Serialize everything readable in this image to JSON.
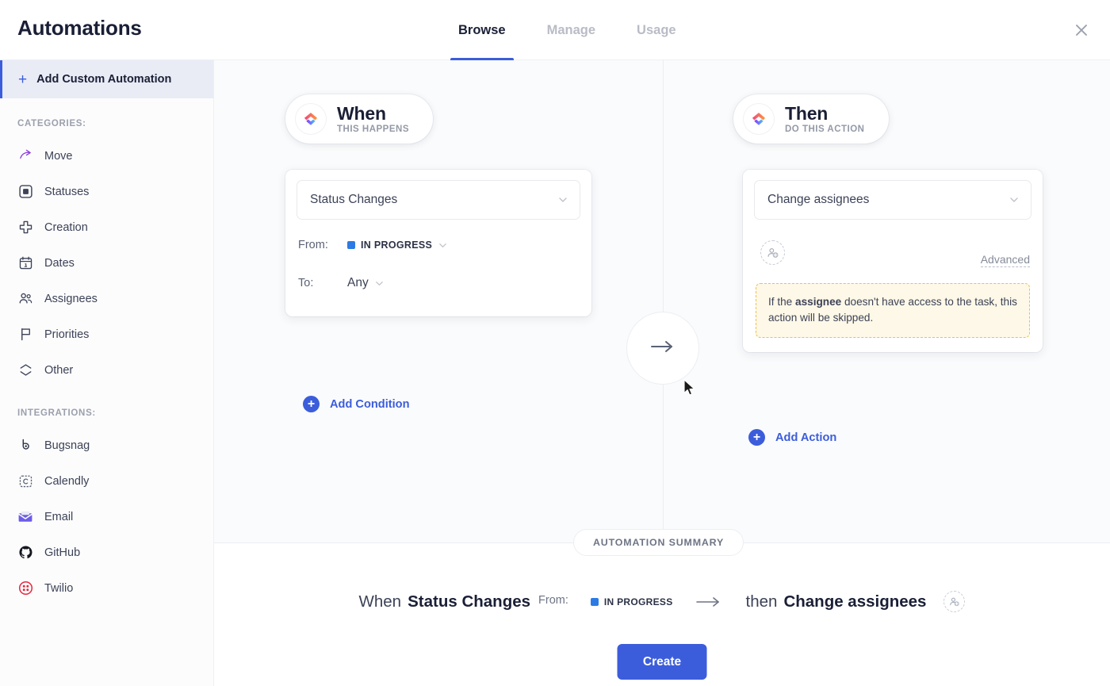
{
  "header": {
    "title": "Automations",
    "tabs": [
      {
        "label": "Browse",
        "active": true
      },
      {
        "label": "Manage",
        "active": false
      },
      {
        "label": "Usage",
        "active": false
      }
    ],
    "close_icon": "close-icon"
  },
  "sidebar": {
    "add_custom": {
      "label": "Add Custom Automation",
      "plus": "+",
      "selected": true
    },
    "categories_label": "CATEGORIES:",
    "categories": [
      {
        "label": "Move",
        "icon": "move-arrow-icon"
      },
      {
        "label": "Statuses",
        "icon": "status-square-icon"
      },
      {
        "label": "Creation",
        "icon": "plus-cross-icon"
      },
      {
        "label": "Dates",
        "icon": "calendar-icon"
      },
      {
        "label": "Assignees",
        "icon": "people-icon"
      },
      {
        "label": "Priorities",
        "icon": "flag-icon"
      },
      {
        "label": "Other",
        "icon": "layers-icon"
      }
    ],
    "integrations_label": "INTEGRATIONS:",
    "integrations": [
      {
        "label": "Bugsnag",
        "icon": "bugsnag-icon",
        "color": "#2c3246"
      },
      {
        "label": "Calendly",
        "icon": "calendly-icon",
        "color": "#5b6275"
      },
      {
        "label": "Email",
        "icon": "email-envelope-icon",
        "color": "#6c5ce7"
      },
      {
        "label": "GitHub",
        "icon": "github-icon",
        "color": "#14181f"
      },
      {
        "label": "Twilio",
        "icon": "twilio-icon",
        "color": "#e8273f"
      }
    ]
  },
  "when_column": {
    "pill_title": "When",
    "pill_subtitle": "THIS HAPPENS",
    "logo_icon": "clickup-logo-icon",
    "trigger_select": "Status Changes",
    "conditions": [
      {
        "label": "From:",
        "value": "IN PROGRESS",
        "color": "#2c7be5",
        "has_dot": true
      },
      {
        "label": "To:",
        "value": "Any",
        "has_dot": false
      }
    ],
    "add_condition_label": "Add Condition"
  },
  "then_column": {
    "pill_title": "Then",
    "pill_subtitle": "DO THIS ACTION",
    "logo_icon": "clickup-logo-icon",
    "action_select": "Change assignees",
    "assignee_placeholder_icon": "add-person-icon",
    "advanced_label": "Advanced",
    "warning": {
      "prefix": "If the ",
      "bold": "assignee",
      "suffix": " doesn't have access to the task, this action will be skipped."
    },
    "add_action_label": "Add Action"
  },
  "connector": {
    "icon": "arrow-right-icon"
  },
  "summary": {
    "badge": "AUTOMATION SUMMARY",
    "when_word": "When",
    "trigger": "Status Changes",
    "from_label": "From:",
    "status": "IN PROGRESS",
    "status_color": "#2c7be5",
    "arrow_icon": "arrow-right-icon",
    "then_word": "then",
    "action": "Change assignees",
    "avatar_icon": "add-person-icon",
    "create_label": "Create"
  },
  "colors": {
    "accent_blue": "#3c5ddb",
    "status_blue": "#2c7be5",
    "warning_bg": "#fdf8e7",
    "warning_border": "#f0c14b",
    "canvas_bg": "#fafbfc"
  }
}
